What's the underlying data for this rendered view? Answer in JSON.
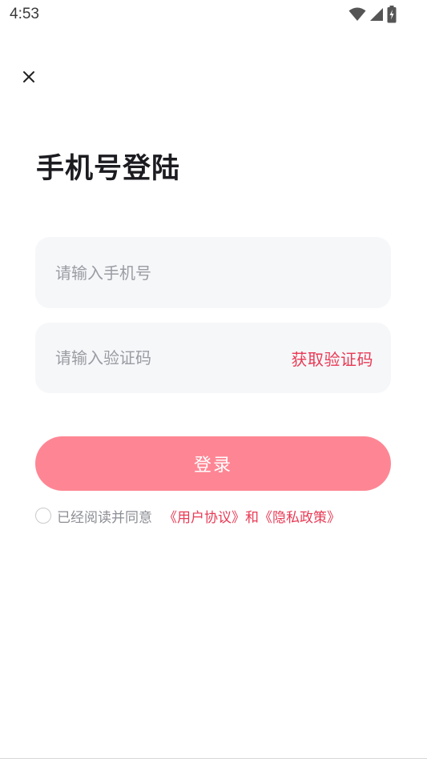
{
  "status_bar": {
    "time": "4:53",
    "icons": [
      "wifi-icon",
      "signal-icon",
      "battery-charging-icon"
    ]
  },
  "header": {
    "close_icon": "close-icon"
  },
  "title": "手机号登陆",
  "phone_field": {
    "value": "",
    "placeholder": "请输入手机号"
  },
  "code_field": {
    "value": "",
    "placeholder": "请输入验证码",
    "get_code_label": "获取验证码"
  },
  "login_button": {
    "label": "登录"
  },
  "agreement": {
    "checked": false,
    "prefix": "已经阅读并同意",
    "user_agreement": "《用户协议》",
    "and": "和",
    "privacy_policy": "《隐私政策》"
  },
  "colors": {
    "accent": "#e83a55",
    "button": "#fe8694",
    "field_bg": "#f6f7f9",
    "placeholder": "#9a9ca3"
  }
}
